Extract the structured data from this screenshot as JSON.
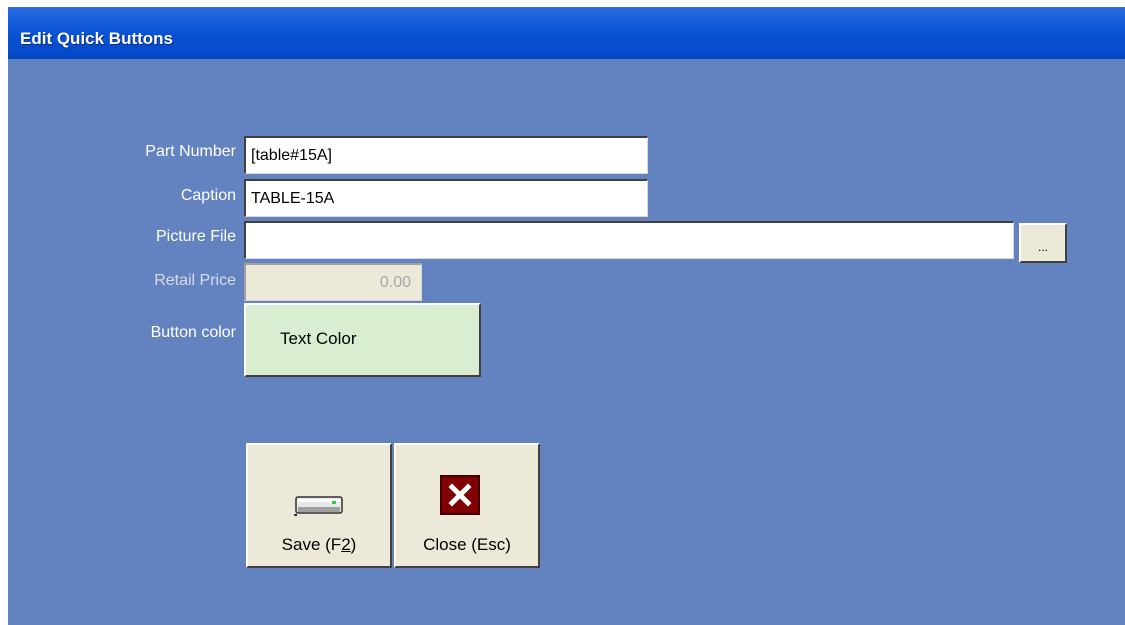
{
  "window": {
    "title": "Edit Quick Buttons"
  },
  "form": {
    "part_number": {
      "label": "Part Number",
      "value": "[table#15A]"
    },
    "caption": {
      "label": "Caption",
      "value": "TABLE-15A"
    },
    "picture_file": {
      "label": "Picture File",
      "value": "",
      "browse_label": "..."
    },
    "retail_price": {
      "label": "Retail Price",
      "value": "0.00"
    },
    "button_color": {
      "label": "Button color",
      "text_color_label": "Text Color",
      "fill_color": "#d9eed0"
    }
  },
  "actions": {
    "save": {
      "label_prefix": "Save (F",
      "hotkey": "2",
      "label_suffix": ")",
      "icon": "save-icon"
    },
    "close": {
      "label": "Close (Esc)",
      "icon": "close-icon"
    }
  },
  "colors": {
    "background": "#6382c0",
    "titlebar": "#0a55d6",
    "button_face": "#ece9d8"
  }
}
